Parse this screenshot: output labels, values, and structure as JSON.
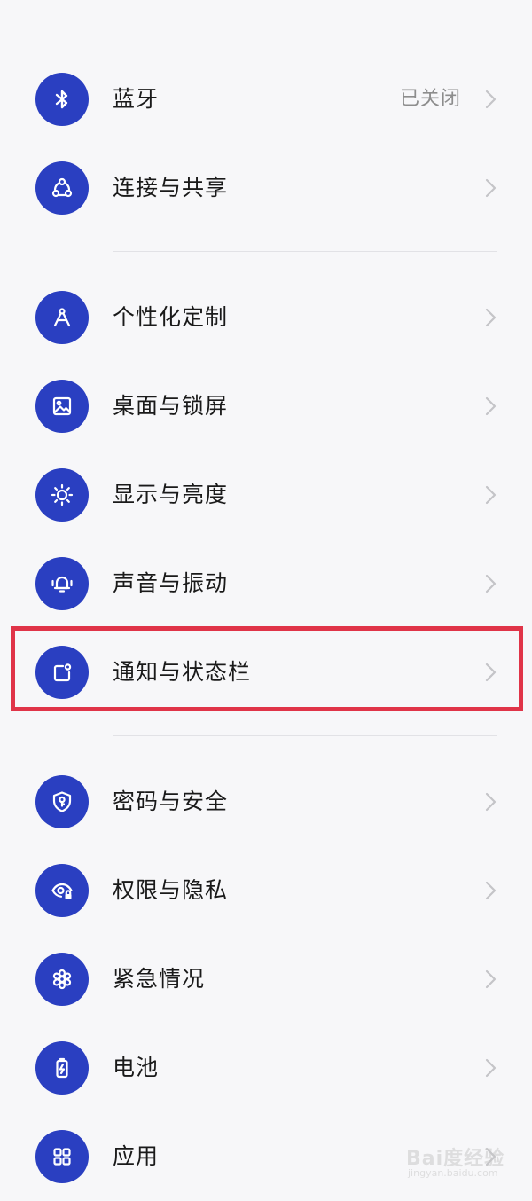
{
  "settings": {
    "items": [
      {
        "label": "蓝牙",
        "value": "已关闭",
        "icon": "bluetooth-icon"
      },
      {
        "label": "连接与共享",
        "value": "",
        "icon": "share-icon"
      },
      {
        "label": "个性化定制",
        "value": "",
        "icon": "compass-icon"
      },
      {
        "label": "桌面与锁屏",
        "value": "",
        "icon": "image-icon"
      },
      {
        "label": "显示与亮度",
        "value": "",
        "icon": "sun-icon"
      },
      {
        "label": "声音与振动",
        "value": "",
        "icon": "bell-icon"
      },
      {
        "label": "通知与状态栏",
        "value": "",
        "icon": "notification-icon"
      },
      {
        "label": "密码与安全",
        "value": "",
        "icon": "shield-icon"
      },
      {
        "label": "权限与隐私",
        "value": "",
        "icon": "eye-lock-icon"
      },
      {
        "label": "紧急情况",
        "value": "",
        "icon": "emergency-icon"
      },
      {
        "label": "电池",
        "value": "",
        "icon": "battery-icon"
      },
      {
        "label": "应用",
        "value": "",
        "icon": "apps-grid-icon"
      }
    ]
  },
  "theme": {
    "icon_bg": "#2a3fc1",
    "highlight": "#e03448",
    "background": "#f7f7f9"
  },
  "watermark": {
    "main": "Bai度经验",
    "sub": "jingyan.baidu.com"
  }
}
